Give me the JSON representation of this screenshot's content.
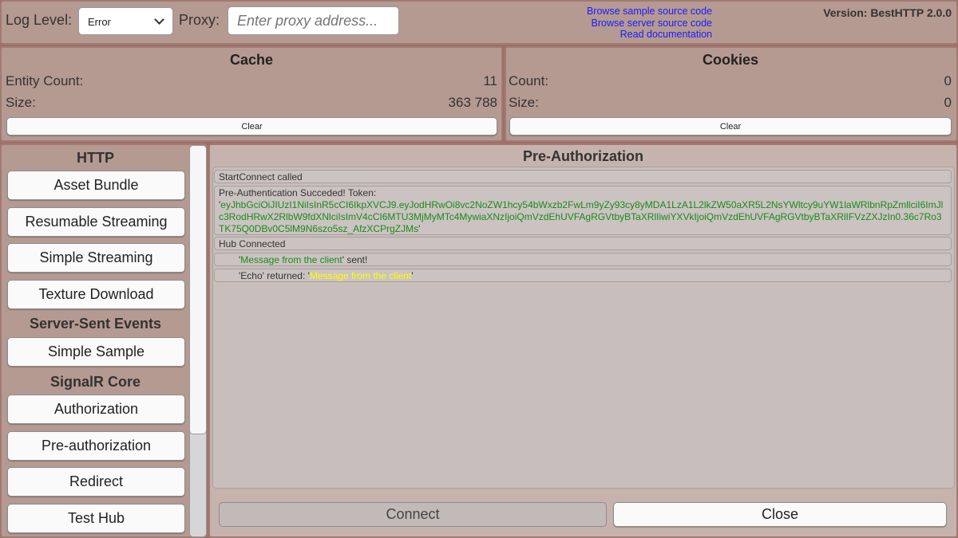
{
  "top": {
    "log_level_label": "Log Level:",
    "log_level_value": "Error",
    "proxy_label": "Proxy:",
    "proxy_placeholder": "Enter proxy address...",
    "links": [
      "Browse sample source code",
      "Browse server source code",
      "Read documentation"
    ],
    "version": "Version: BestHTTP 2.0.0"
  },
  "cache": {
    "title": "Cache",
    "entity_label": "Entity Count:",
    "entity_value": "11",
    "size_label": "Size:",
    "size_value": "363 788",
    "clear": "Clear"
  },
  "cookies": {
    "title": "Cookies",
    "count_label": "Count:",
    "count_value": "0",
    "size_label": "Size:",
    "size_value": "0",
    "clear": "Clear"
  },
  "sidebar": {
    "http": "HTTP",
    "sse": "Server-Sent Events",
    "signalr": "SignalR Core",
    "items": [
      "Asset Bundle",
      "Resumable Streaming",
      "Simple Streaming",
      "Texture Download",
      "Simple Sample",
      "Authorization",
      "Pre-authorization",
      "Redirect",
      "Test Hub"
    ]
  },
  "main": {
    "title": "Pre-Authorization",
    "log": {
      "l1": "StartConnect called",
      "l2_prefix": "Pre-Authentication Succeded! Token:",
      "token": "eyJhbGciOiJIUzI1NiIsInR5cCI6IkpXVCJ9.eyJodHRwOi8vc2NoZW1hcy54bWxzb2FwLm9yZy93cy8yMDA1LzA1L2lkZW50aXR5L2NsYWltcy9uYW1laWRlbnRpZmllciI6ImJlc3RodHRwX2RlbW9fdXNlciIsImV4cCI6MTU3MjMyMTc4MywiaXNzIjoiQmVzdEhUVFAgRGVtbyBTaXRlIiwiYXVkIjoiQmVzdEhUVFAgRGVtbyBTaXRlIFVzZXJzIn0.36c7Ro3TK75Q0DBv0C5lM9N6szo5sz_AfzXCPrgZJMs",
      "l3": "Hub Connected",
      "l4_msg": "Message from the client",
      "l4_suffix": "' sent!",
      "l5_prefix": "'Echo' returned: '",
      "l5_msg": "Message from the client",
      "quote": "'"
    },
    "connect": "Connect",
    "close": "Close"
  }
}
